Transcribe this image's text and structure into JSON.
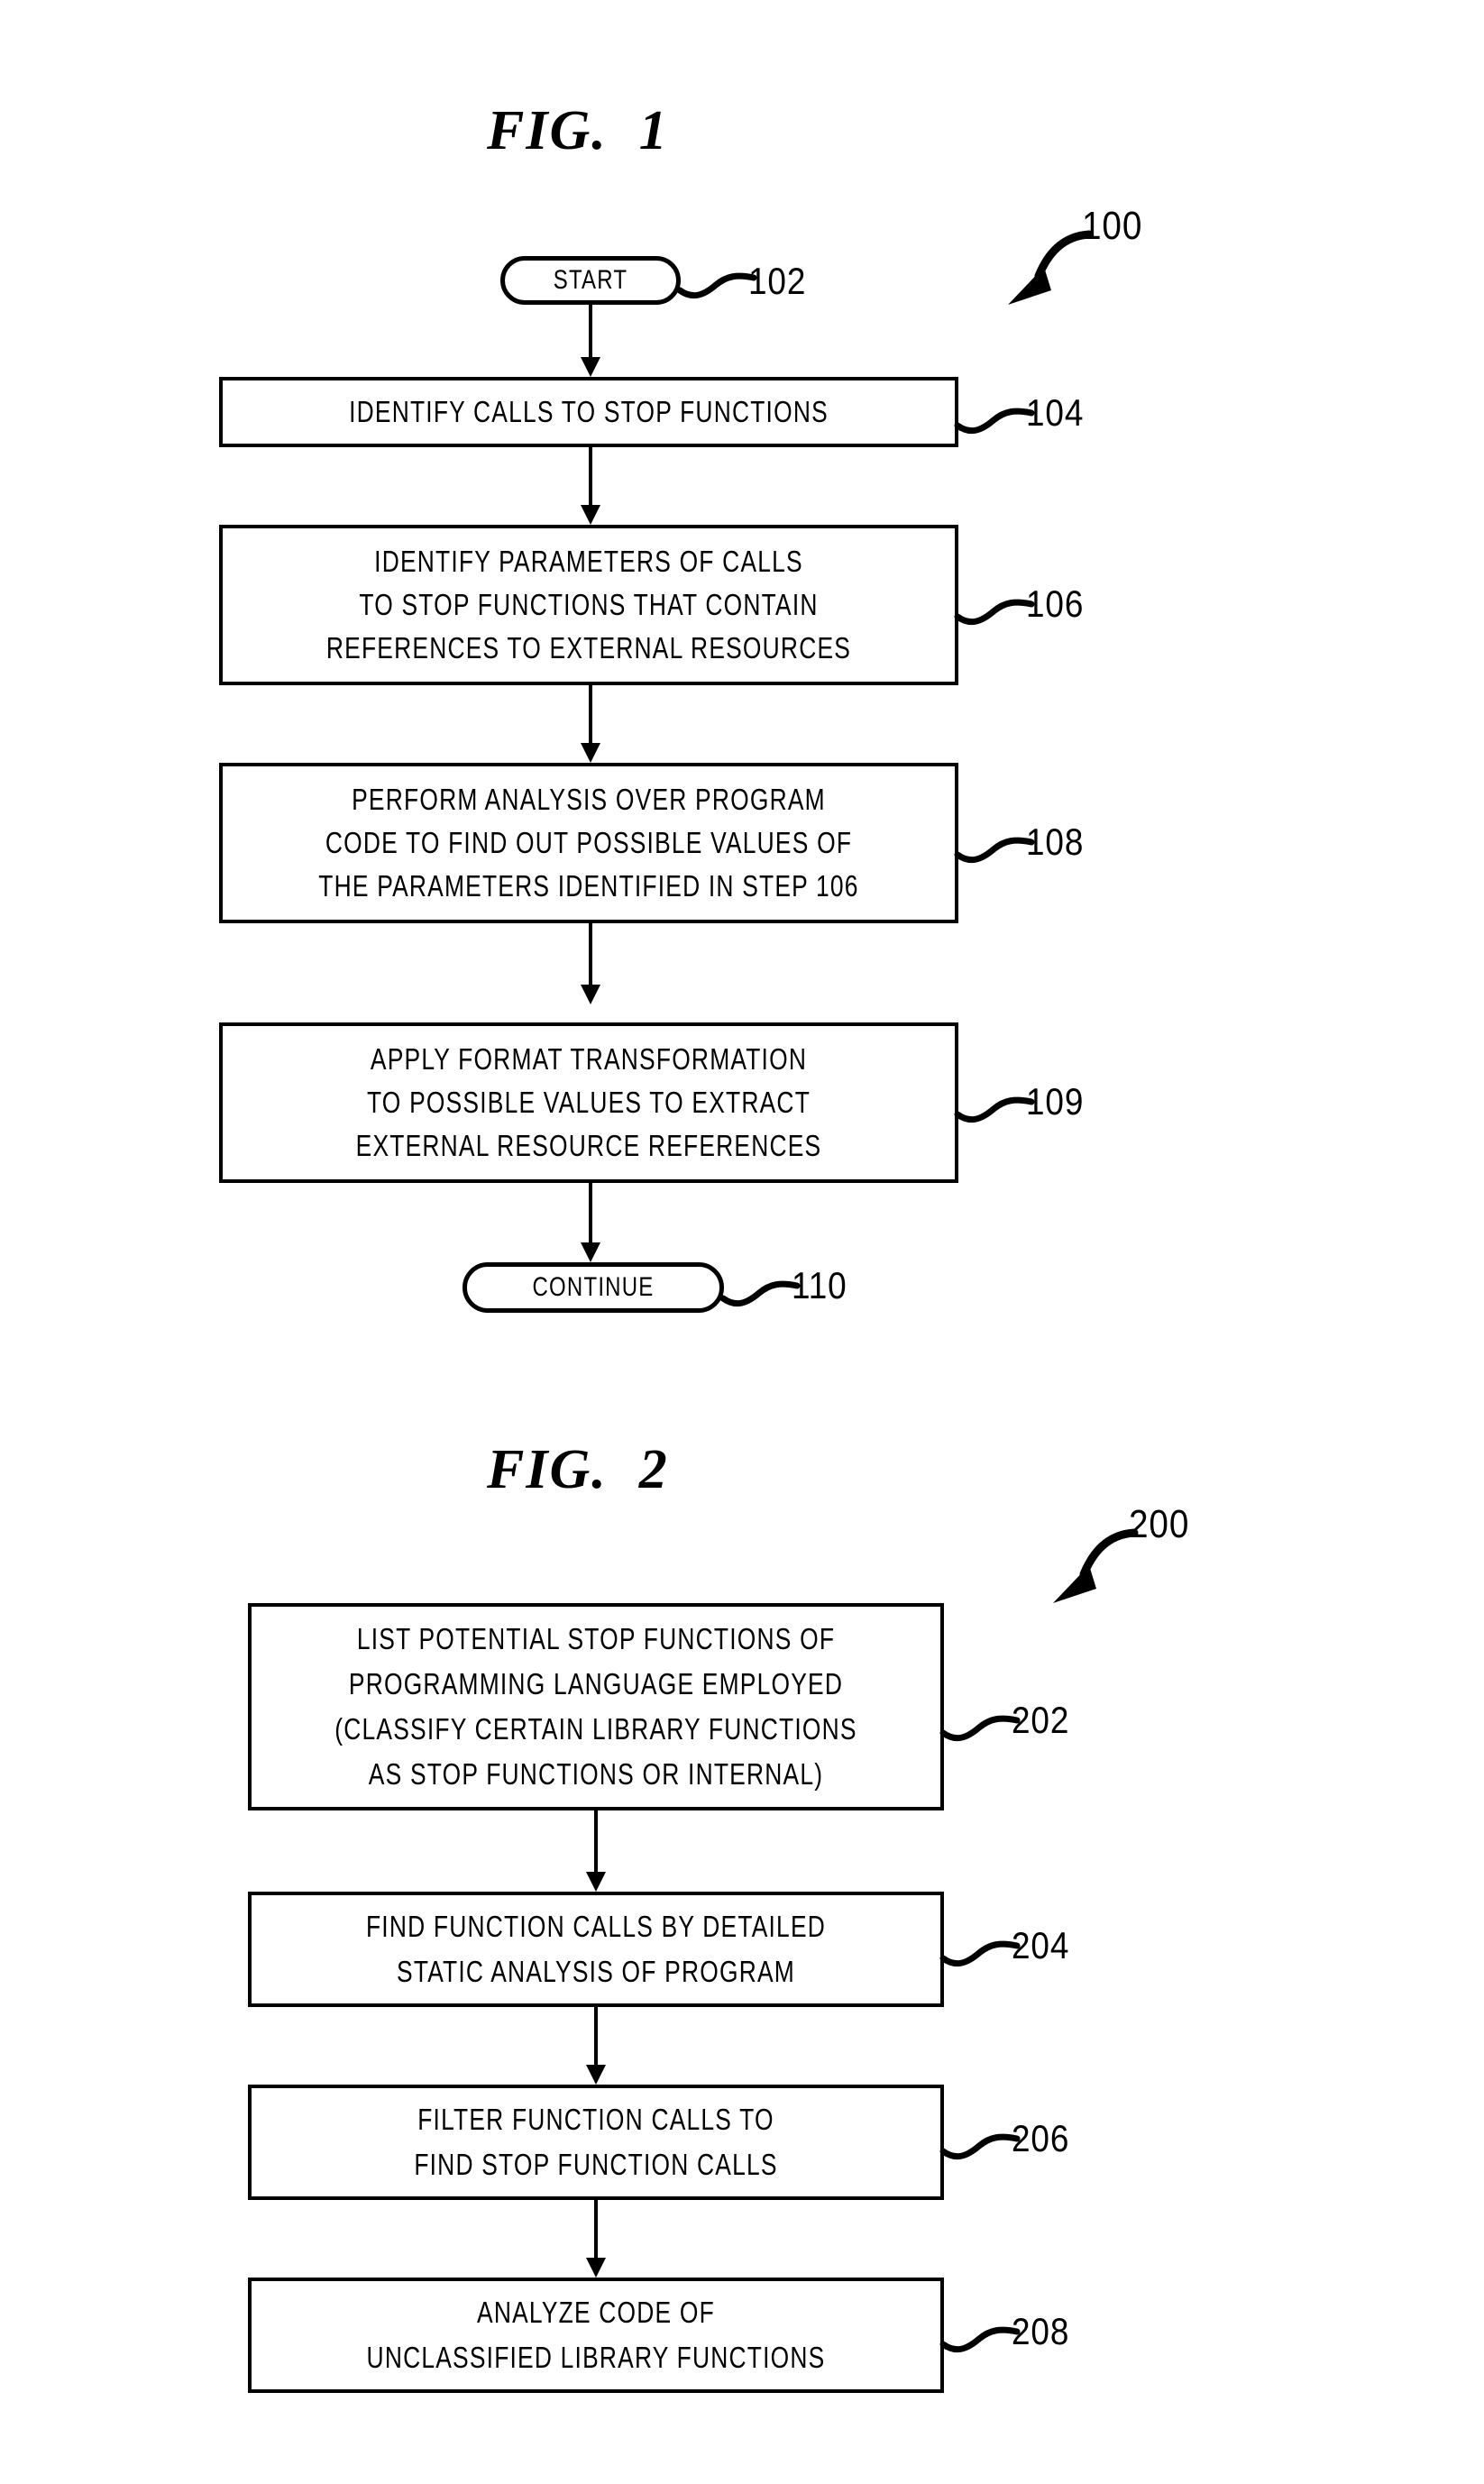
{
  "figures": [
    {
      "id": "fig1",
      "title": "FIG.  1",
      "figure_number": "100",
      "nodes": [
        {
          "id": "n102",
          "shape": "terminal",
          "label": "START",
          "ref": "102"
        },
        {
          "id": "n104",
          "shape": "process",
          "label": "IDENTIFY CALLS TO STOP FUNCTIONS",
          "ref": "104"
        },
        {
          "id": "n106",
          "shape": "process",
          "label": "IDENTIFY PARAMETERS OF CALLS\nTO STOP FUNCTIONS THAT CONTAIN\nREFERENCES TO EXTERNAL RESOURCES",
          "ref": "106"
        },
        {
          "id": "n108",
          "shape": "process",
          "label": "PERFORM ANALYSIS OVER PROGRAM\nCODE TO FIND OUT POSSIBLE VALUES OF\nTHE PARAMETERS IDENTIFIED IN STEP 106",
          "ref": "108"
        },
        {
          "id": "n109",
          "shape": "process",
          "label": "APPLY FORMAT TRANSFORMATION\nTO POSSIBLE VALUES TO EXTRACT\nEXTERNAL RESOURCE REFERENCES",
          "ref": "109"
        },
        {
          "id": "n110",
          "shape": "terminal",
          "label": "CONTINUE",
          "ref": "110"
        }
      ]
    },
    {
      "id": "fig2",
      "title": "FIG.  2",
      "figure_number": "200",
      "nodes": [
        {
          "id": "n202",
          "shape": "process",
          "label": "LIST POTENTIAL STOP FUNCTIONS OF\nPROGRAMMING LANGUAGE EMPLOYED\n(CLASSIFY CERTAIN LIBRARY FUNCTIONS\nAS STOP FUNCTIONS OR INTERNAL)",
          "ref": "202"
        },
        {
          "id": "n204",
          "shape": "process",
          "label": "FIND FUNCTION CALLS BY DETAILED\nSTATIC ANALYSIS OF PROGRAM",
          "ref": "204"
        },
        {
          "id": "n206",
          "shape": "process",
          "label": "FILTER FUNCTION CALLS TO\nFIND STOP FUNCTION CALLS",
          "ref": "206"
        },
        {
          "id": "n208",
          "shape": "process",
          "label": "ANALYZE CODE OF\nUNCLASSIFIED LIBRARY FUNCTIONS",
          "ref": "208"
        }
      ]
    }
  ],
  "colors": {
    "ink": "#000000",
    "paper": "#ffffff"
  }
}
